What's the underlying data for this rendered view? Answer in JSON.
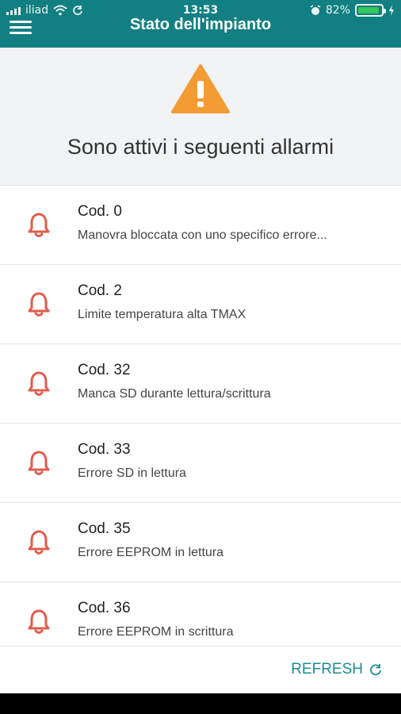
{
  "status_bar": {
    "carrier": "iliad",
    "time": "13:53",
    "battery_percent": "82%",
    "battery_level": 0.82,
    "icons": [
      "signal-icon",
      "wifi-icon",
      "sync-icon",
      "alarm-clock-icon",
      "battery-icon",
      "charging-icon"
    ]
  },
  "nav": {
    "title": "Stato dell'impianto",
    "menu_icon": "hamburger-menu-icon"
  },
  "alert": {
    "icon": "warning-triangle-icon",
    "title": "Sono attivi i seguenti allarmi",
    "color": "#f39c34"
  },
  "alarms": [
    {
      "code": "Cod. 0",
      "description": "Manovra bloccata con uno specifico errore..."
    },
    {
      "code": "Cod. 2",
      "description": "Limite temperatura alta TMAX"
    },
    {
      "code": "Cod. 32",
      "description": "Manca SD durante lettura/scrittura"
    },
    {
      "code": "Cod. 33",
      "description": "Errore SD in lettura"
    },
    {
      "code": "Cod. 35",
      "description": "Errore EEPROM in lettura"
    },
    {
      "code": "Cod. 36",
      "description": "Errore EEPROM in scrittura"
    }
  ],
  "alarm_icon_color": "#e35b4b",
  "footer": {
    "refresh_label": "REFRESH",
    "refresh_icon": "refresh-icon"
  },
  "colors": {
    "primary": "#127f82",
    "accent": "#1c8e90"
  }
}
